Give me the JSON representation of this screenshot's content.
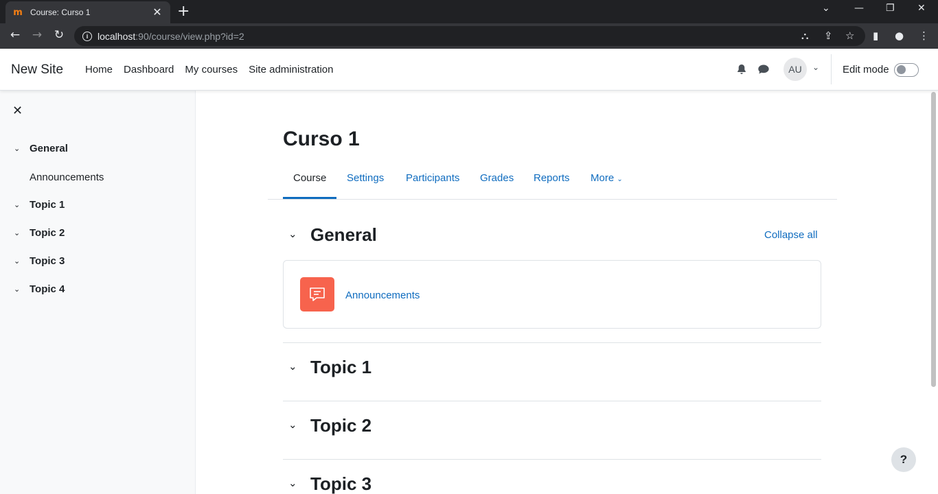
{
  "browser": {
    "tab_title": "Course: Curso 1",
    "tab_favicon": "moodle-favicon",
    "url_host": "localhost",
    "url_rest": ":90/course/view.php?id=2"
  },
  "navbar": {
    "site_name": "New Site",
    "links": [
      "Home",
      "Dashboard",
      "My courses",
      "Site administration"
    ],
    "avatar_initials": "AU",
    "edit_mode_label": "Edit mode",
    "edit_mode_on": false
  },
  "course_index": {
    "sections": [
      {
        "label": "General",
        "items": [
          "Announcements"
        ]
      },
      {
        "label": "Topic 1",
        "items": []
      },
      {
        "label": "Topic 2",
        "items": []
      },
      {
        "label": "Topic 3",
        "items": []
      },
      {
        "label": "Topic 4",
        "items": []
      }
    ]
  },
  "course": {
    "title": "Curso 1",
    "tabs": [
      "Course",
      "Settings",
      "Participants",
      "Grades",
      "Reports",
      "More"
    ],
    "active_tab": "Course",
    "collapse_all_label": "Collapse all",
    "sections": [
      {
        "title": "General",
        "activities": [
          {
            "name": "Announcements",
            "icon": "forum-icon"
          }
        ]
      },
      {
        "title": "Topic 1",
        "activities": []
      },
      {
        "title": "Topic 2",
        "activities": []
      },
      {
        "title": "Topic 3",
        "activities": []
      }
    ]
  },
  "help_label": "?",
  "colors": {
    "link": "#0f6cbf",
    "forum_icon_bg": "#f7634d",
    "drawer_bg": "#f8f9fa"
  }
}
